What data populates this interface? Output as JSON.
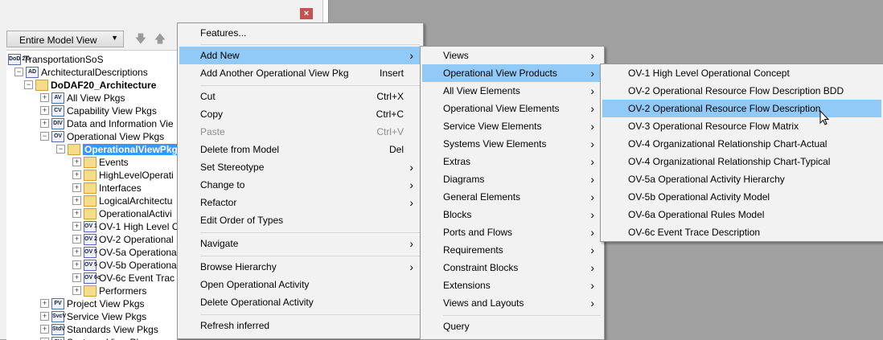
{
  "panel": {
    "close_icon": "close-icon",
    "model_selector": "Entire Model View",
    "move_down_icon": "down-arrow-icon",
    "move_up_icon": "up-arrow-icon"
  },
  "tree": [
    {
      "label": "TransportationSoS",
      "icon": "DoD 2.0",
      "expander": ""
    },
    {
      "label": "ArchitecturalDescriptions",
      "icon": "AD",
      "expander": "−"
    },
    {
      "label": "DoDAF20_Architecture",
      "icon": "",
      "expander": "−",
      "bold": true
    },
    {
      "label": "All View Pkgs",
      "icon": "AV",
      "expander": "+"
    },
    {
      "label": "Capability View Pkgs",
      "icon": "CV",
      "expander": "+"
    },
    {
      "label": "Data and Information Vie",
      "icon": "DIV",
      "expander": "+"
    },
    {
      "label": "Operational View Pkgs",
      "icon": "OV",
      "expander": "−"
    },
    {
      "label": "OperationalViewPkg",
      "icon": "",
      "expander": "−",
      "selected": true
    },
    {
      "label": "Events",
      "icon": "",
      "expander": "+"
    },
    {
      "label": "HighLevelOperati",
      "icon": "",
      "expander": "+"
    },
    {
      "label": "Interfaces",
      "icon": "",
      "expander": "+"
    },
    {
      "label": "LogicalArchitectu",
      "icon": "",
      "expander": "+"
    },
    {
      "label": "OperationalActivi",
      "icon": "",
      "expander": "+"
    },
    {
      "label": "OV-1 High Level C",
      "icon": "OV 1",
      "expander": "+"
    },
    {
      "label": "OV-2 Operational",
      "icon": "OV 2",
      "expander": "+"
    },
    {
      "label": "OV-5a Operational",
      "icon": "OV 5",
      "expander": "+"
    },
    {
      "label": "OV-5b Operationa",
      "icon": "OV 5",
      "expander": "+"
    },
    {
      "label": "OV-6c Event Trac",
      "icon": "OV 6c",
      "expander": "+"
    },
    {
      "label": "Performers",
      "icon": "",
      "expander": "+"
    },
    {
      "label": "Project View Pkgs",
      "icon": "PV",
      "expander": "+"
    },
    {
      "label": "Service View Pkgs",
      "icon": "SvcV",
      "expander": "+"
    },
    {
      "label": "Standards View Pkgs",
      "icon": "StdV",
      "expander": "+"
    },
    {
      "label": "Systems View Pkgs",
      "icon": "SV",
      "expander": "+"
    }
  ],
  "context_menu": [
    {
      "label": "Features...",
      "shortcut": "",
      "submenu": false
    },
    {
      "label": "Add New",
      "shortcut": "",
      "submenu": true,
      "highlighted": true
    },
    {
      "label": "Add Another Operational View Pkg",
      "shortcut": "Insert",
      "submenu": false
    },
    {
      "label": "Cut",
      "shortcut": "Ctrl+X",
      "submenu": false
    },
    {
      "label": "Copy",
      "shortcut": "Ctrl+C",
      "submenu": false
    },
    {
      "label": "Paste",
      "shortcut": "Ctrl+V",
      "submenu": false,
      "disabled": true
    },
    {
      "label": "Delete from Model",
      "shortcut": "Del",
      "submenu": false
    },
    {
      "label": "Set Stereotype",
      "shortcut": "",
      "submenu": true
    },
    {
      "label": "Change to",
      "shortcut": "",
      "submenu": true
    },
    {
      "label": "Refactor",
      "shortcut": "",
      "submenu": true
    },
    {
      "label": "Edit Order of Types",
      "shortcut": "",
      "submenu": false
    },
    {
      "label": "Navigate",
      "shortcut": "",
      "submenu": true
    },
    {
      "label": "Browse Hierarchy",
      "shortcut": "",
      "submenu": true
    },
    {
      "label": "Open Operational Activity",
      "shortcut": "",
      "submenu": false
    },
    {
      "label": "Delete Operational Activity",
      "shortcut": "",
      "submenu": false
    },
    {
      "label": "Refresh inferred",
      "shortcut": "",
      "submenu": false
    }
  ],
  "add_new_menu": [
    {
      "label": "Views",
      "submenu": true
    },
    {
      "label": "Operational View Products",
      "submenu": true,
      "highlighted": true
    },
    {
      "label": "All View Elements",
      "submenu": true
    },
    {
      "label": "Operational View Elements",
      "submenu": true
    },
    {
      "label": "Service View Elements",
      "submenu": true
    },
    {
      "label": "Systems View Elements",
      "submenu": true
    },
    {
      "label": "Extras",
      "submenu": true
    },
    {
      "label": "Diagrams",
      "submenu": true
    },
    {
      "label": "General Elements",
      "submenu": true
    },
    {
      "label": "Blocks",
      "submenu": true
    },
    {
      "label": "Ports and Flows",
      "submenu": true
    },
    {
      "label": "Requirements",
      "submenu": true
    },
    {
      "label": "Constraint Blocks",
      "submenu": true
    },
    {
      "label": "Extensions",
      "submenu": true
    },
    {
      "label": "Views and Layouts",
      "submenu": true
    },
    {
      "label": "Query",
      "submenu": false
    }
  ],
  "ov_products_menu": [
    {
      "label": "OV-1 High Level Operational Concept"
    },
    {
      "label": "OV-2 Operational Resource Flow Description BDD"
    },
    {
      "label": "OV-2 Operational Resource Flow Description",
      "highlighted": true
    },
    {
      "label": "OV-3 Operational Resource Flow Matrix"
    },
    {
      "label": "OV-4 Organizational Relationship Chart-Actual"
    },
    {
      "label": "OV-4 Organizational Relationship Chart-Typical"
    },
    {
      "label": "OV-5a Operational Activity Hierarchy"
    },
    {
      "label": "OV-5b Operational Activity Model"
    },
    {
      "label": "OV-6a Operational Rules Model"
    },
    {
      "label": "OV-6c Event Trace Description"
    }
  ],
  "colors": {
    "highlight": "#91c9f7",
    "selection": "#3399ff",
    "menu_bg": "#f2f2f2",
    "workspace": "#a0a0a0"
  }
}
